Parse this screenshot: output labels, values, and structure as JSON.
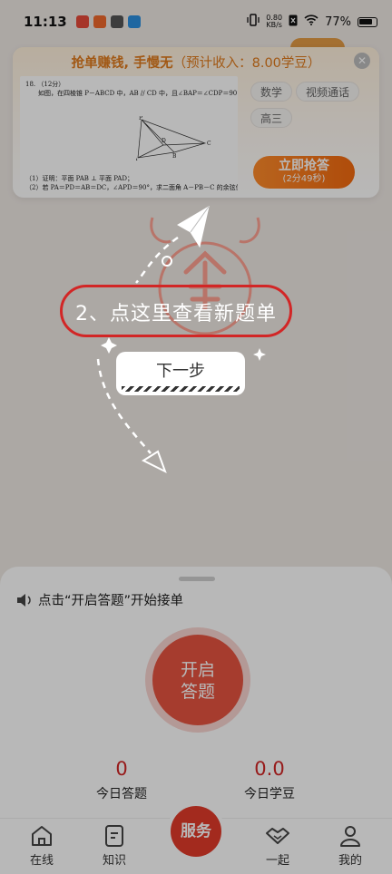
{
  "status_bar": {
    "time": "11:13",
    "net_speed_value": "0.80",
    "net_speed_unit": "KB/s",
    "battery": "77%"
  },
  "card": {
    "title": "抢单赚钱, 手慢无",
    "income": "（预计收入：8.00学豆）",
    "close": "✕",
    "question": {
      "number": "18.",
      "score": "（12分）",
      "stem": "如图，在四棱锥 P－ABCD 中，AB // CD 中，且∠BAP＝∠CDP＝90°.",
      "part1": "（1）证明：平面 PAB ⊥ 平面 PAD；",
      "part2": "（2）若 PA＝PD＝AB＝DC，∠APD＝90°，求二面角 A－PB－C 的余弦值.",
      "labels": [
        "P",
        "D",
        "C",
        "A",
        "B"
      ]
    },
    "tags": [
      "数学",
      "视频通话",
      "高三"
    ],
    "grab_button": "立即抢答",
    "countdown": "(2分49秒)"
  },
  "guide": {
    "hint": "2、点这里查看新题单",
    "next_button": "下一步"
  },
  "panel": {
    "notice": "点击“开启答题”开始接单",
    "start_line1": "开启",
    "start_line2": "答题",
    "stats": [
      {
        "value": "0",
        "label": "今日答题"
      },
      {
        "value": "0.0",
        "label": "今日学豆"
      }
    ]
  },
  "tabs": {
    "online": "在线",
    "knowledge": "知识",
    "service": "服务",
    "together": "一起",
    "mine": "我的"
  },
  "colors": {
    "accent_orange": "#f36a0f",
    "accent_red": "#e23b2a",
    "hint_border": "#d22626"
  }
}
